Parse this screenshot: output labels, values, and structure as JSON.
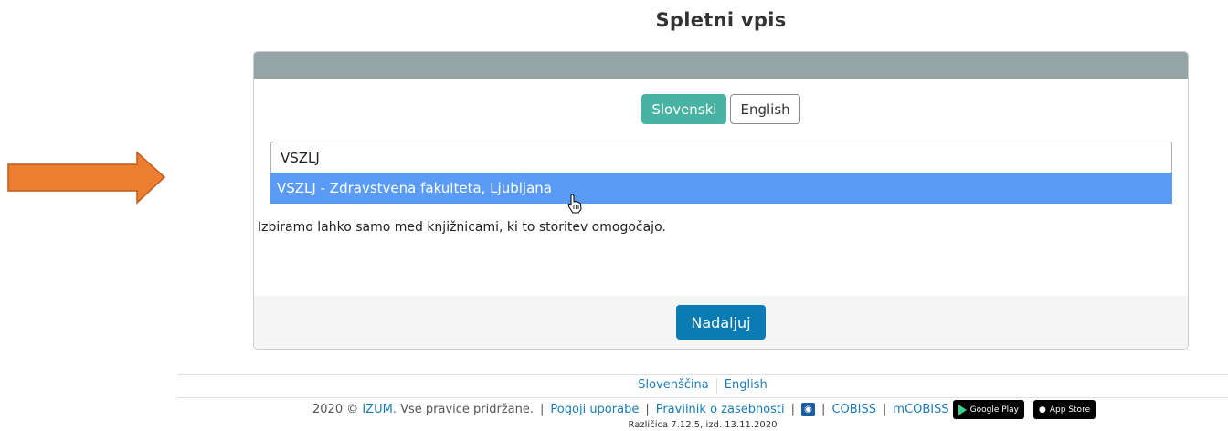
{
  "page": {
    "title": "Spletni vpis"
  },
  "language_buttons": {
    "slovenski": "Slovenski",
    "english": "English"
  },
  "search": {
    "value": "VSZLJ",
    "placeholder": ""
  },
  "dropdown": {
    "option_1": "VSZLJ - Zdravstvena fakulteta, Ljubljana"
  },
  "info": {
    "text": "Izbiramo lahko samo med knjižnicami, ki to storitev omogočajo."
  },
  "actions": {
    "continue_label": "Nadaljuj"
  },
  "footer": {
    "lang_sl": "Slovenščina",
    "lang_en": "English",
    "copyright_prefix": "2020 ©",
    "izum": "IZUM.",
    "rights": "Vse pravice pridržane.",
    "terms": "Pogoji uporabe",
    "privacy": "Pravilnik o zasebnosti",
    "cobiss": "COBISS",
    "mcobiss": "mCOBISS",
    "google_play": "Google Play",
    "app_store": "App Store",
    "version": "Različica 7.12.5, izd. 13.11.2020"
  },
  "colors": {
    "header": "#95a5a6",
    "active_lang": "#48b3a3",
    "highlight": "#5a9bf5",
    "primary": "#0b7bb3",
    "arrow": "#ed7d31"
  }
}
